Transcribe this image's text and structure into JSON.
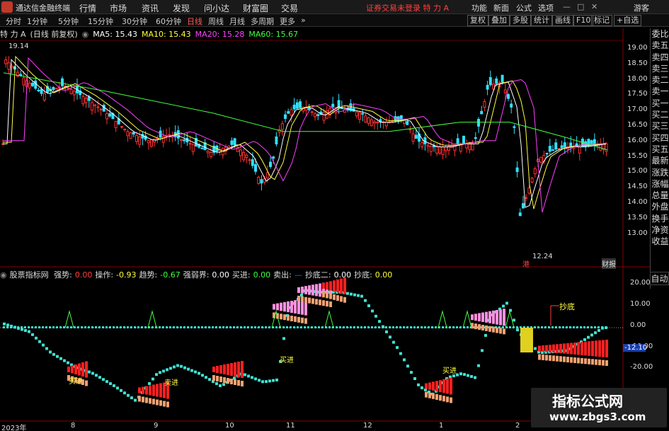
{
  "app": {
    "title": "通达信金融终端",
    "menus": [
      "行情",
      "市场",
      "资讯",
      "发现",
      "问小达",
      "财富圈",
      "交易"
    ],
    "status": "证券交易未登录  特 力 A",
    "right_menus": [
      "功能",
      "新面",
      "公式",
      "选项"
    ],
    "user": "游客"
  },
  "periods": {
    "items": [
      "分时",
      "1分钟",
      "5分钟",
      "15分钟",
      "30分钟",
      "60分钟",
      "日线",
      "周线",
      "月线",
      "多周期",
      "更多"
    ],
    "active": "日线"
  },
  "toolbar_buttons": [
    "复权",
    "叠加",
    "多股",
    "统计",
    "画线",
    "F10",
    "标记",
    "+自选"
  ],
  "main_header": {
    "name": "特 力 A",
    "sub": "(日线 前复权)",
    "ma5": "MA5: 15.43",
    "ma10": "MA10: 15.43",
    "ma20": "MA20: 15.28",
    "ma60": "MA60: 15.67"
  },
  "price_axis": [
    "19.00",
    "18.50",
    "18.00",
    "17.50",
    "17.00",
    "16.50",
    "16.00",
    "15.50",
    "15.00",
    "14.50",
    "14.00",
    "13.50",
    "13.00"
  ],
  "annotations": {
    "high_label": "19.14",
    "low_label": "12.24",
    "event_tag": "财报",
    "event_tag2": "港"
  },
  "side_panel": [
    "委比",
    "卖五",
    "卖四",
    "卖三",
    "卖二",
    "卖一",
    "买一",
    "买二",
    "买三",
    "买四",
    "买五",
    "最新",
    "涨跌",
    "涨幅",
    "总量",
    "外盘",
    "换手",
    "净资",
    "收益",
    "自动"
  ],
  "indicator_header": {
    "name": "股票指标网",
    "items": [
      {
        "label": "强势:",
        "value": "0.00",
        "color": "#ff4040"
      },
      {
        "label": "操作:",
        "value": "-0.93",
        "color": "#ffff40"
      },
      {
        "label": "趋势:",
        "value": "-0.67",
        "color": "#40ff40"
      },
      {
        "label": "强弱界:",
        "value": "0.00",
        "color": "#ffffff"
      },
      {
        "label": "买进:",
        "value": "0.00",
        "color": "#40ff40"
      },
      {
        "label": "卖出:",
        "value": "—",
        "color": "#4060ff"
      },
      {
        "label": "抄底二:",
        "value": "0.00",
        "color": "#ffffff"
      },
      {
        "label": "抄底:",
        "value": "0.00",
        "color": "#ffff40"
      }
    ]
  },
  "indicator_axis": [
    "20.00",
    "10.00",
    "0.00",
    "-10.00",
    "-20.00"
  ],
  "indicator_value_box": "-12.10",
  "indicator_labels": [
    "抄底",
    "买进",
    "卖进",
    "买进",
    "买进"
  ],
  "x_axis": [
    "2023年",
    "8",
    "9",
    "10",
    "11",
    "12",
    "1",
    "2"
  ],
  "watermark": {
    "line1": "指标公式网",
    "line2": "www.zbgs3.com"
  }
}
